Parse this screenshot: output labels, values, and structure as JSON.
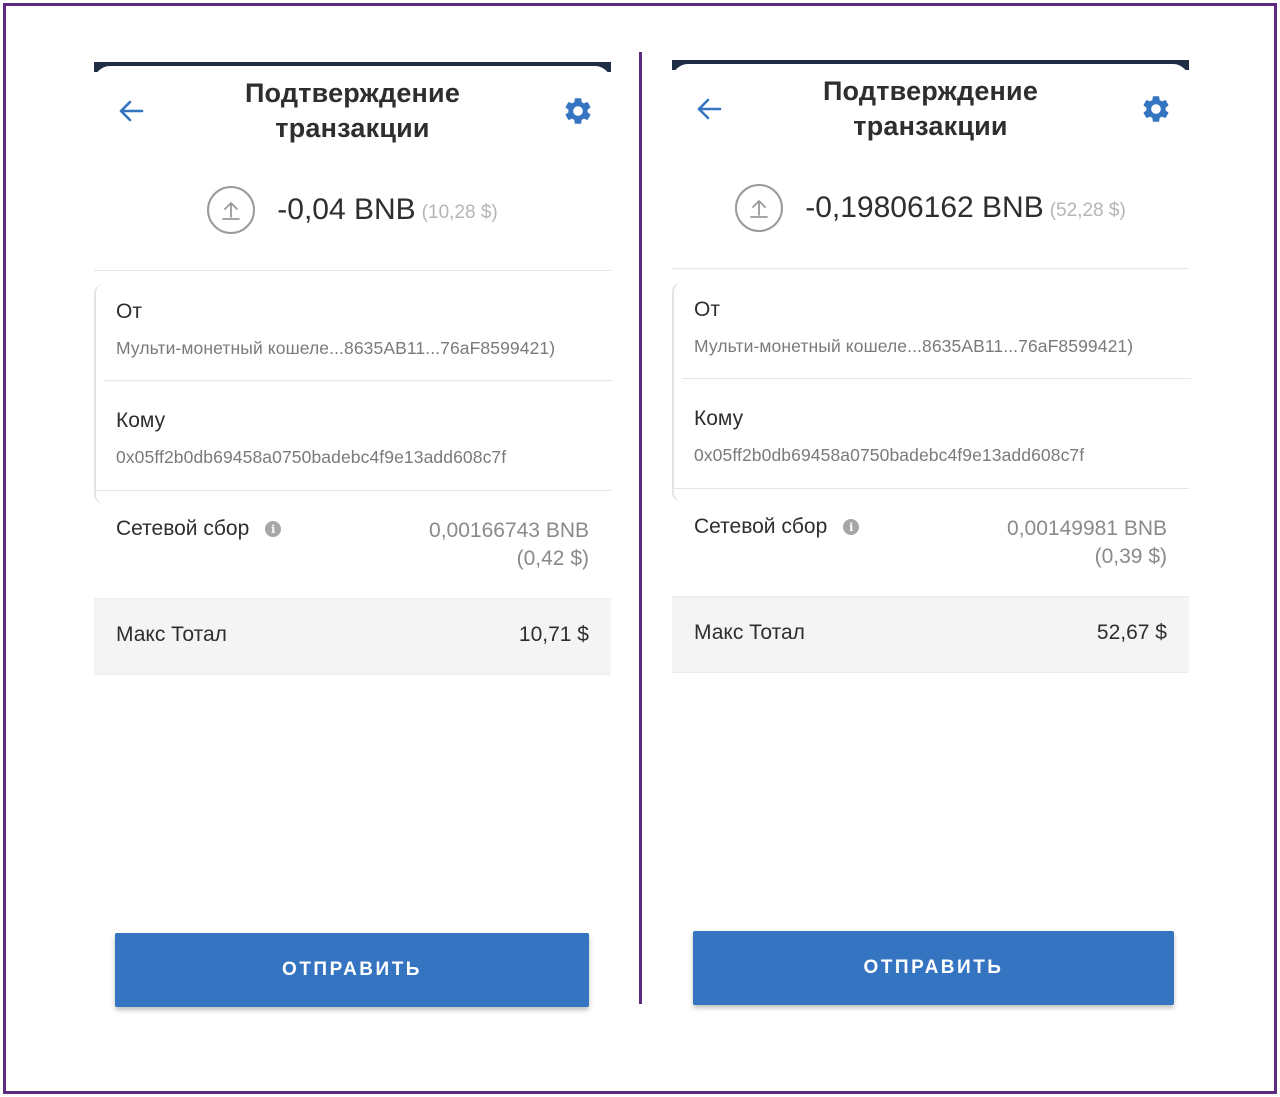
{
  "colors": {
    "accent": "#3574c0",
    "frame": "#5c2a7e",
    "topbar": "#1f2d45"
  },
  "screens": [
    {
      "header": {
        "back_icon": "arrow-left-icon",
        "title_line1": "Подтверждение",
        "title_line2": "транзакции",
        "settings_icon": "gear-icon"
      },
      "amount": {
        "icon": "upload-arrow-icon",
        "value": "-0,04 BNB",
        "usd": "(10,28 $)"
      },
      "from": {
        "label": "От",
        "value": "Мульти-монетный кошеле...8635AB11...76aF8599421)"
      },
      "to": {
        "label": "Кому",
        "value": "0x05ff2b0db69458a0750badebc4f9e13add608c7f"
      },
      "fee": {
        "label": "Сетевой сбор",
        "info_icon": "info-icon",
        "value": "0,00166743 BNB",
        "usd": "(0,42 $)"
      },
      "total": {
        "label": "Макс Тотал",
        "value": "10,71 $"
      },
      "send_label": "ОТПРАВИТЬ"
    },
    {
      "header": {
        "back_icon": "arrow-left-icon",
        "title_line1": "Подтверждение",
        "title_line2": "транзакции",
        "settings_icon": "gear-icon"
      },
      "amount": {
        "icon": "upload-arrow-icon",
        "value": "-0,19806162 BNB",
        "usd": "(52,28 $)"
      },
      "from": {
        "label": "От",
        "value": "Мульти-монетный кошеле...8635AB11...76aF8599421)"
      },
      "to": {
        "label": "Кому",
        "value": "0x05ff2b0db69458a0750badebc4f9e13add608c7f"
      },
      "fee": {
        "label": "Сетевой сбор",
        "info_icon": "info-icon",
        "value": "0,00149981 BNB",
        "usd": "(0,39 $)"
      },
      "total": {
        "label": "Макс Тотал",
        "value": "52,67 $"
      },
      "send_label": "ОТПРАВИТЬ"
    }
  ]
}
